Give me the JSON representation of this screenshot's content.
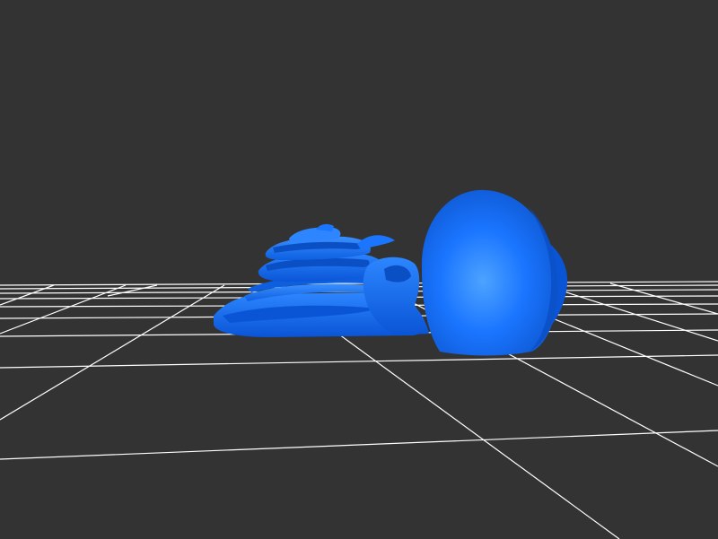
{
  "viewport": {
    "background_color": "#333333",
    "grid_color": "#ffffff",
    "model_color": "#1a75ff",
    "model_highlight_color": "#4da3ff",
    "model_shadow_color": "#0a4fc4"
  }
}
